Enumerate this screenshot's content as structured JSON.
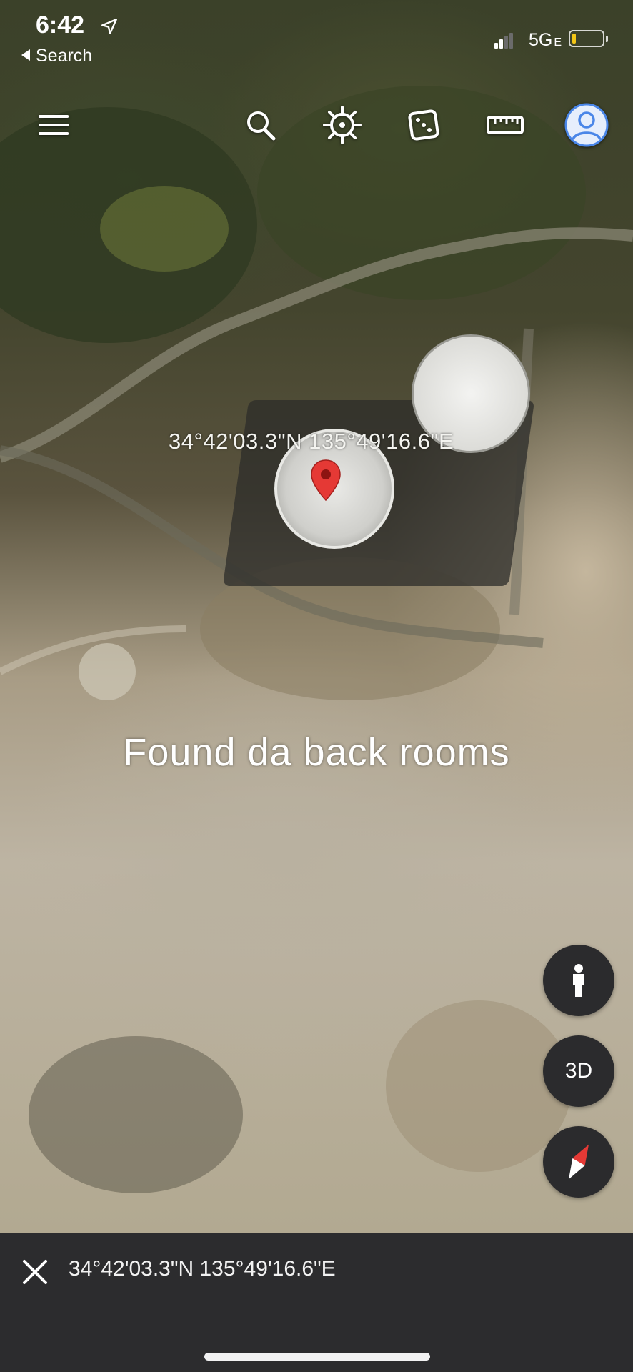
{
  "status_bar": {
    "time": "6:42",
    "back_label": "Search",
    "network": "5G",
    "network_suffix": "E",
    "battery_color": "#f2c616"
  },
  "toolbar": {
    "icons": [
      "menu-icon",
      "search-icon",
      "voyager-icon",
      "feeling-lucky-dice-icon",
      "measure-ruler-icon",
      "account-icon"
    ]
  },
  "map": {
    "pin_coordinates": "34°42'03.3\"N 135°49'16.6\"E",
    "pin_color": "#e53935",
    "caption": "Found da back rooms"
  },
  "controls": {
    "street_view_icon": "pegman-icon",
    "view_mode_label": "3D",
    "compass_icon": "compass-icon"
  },
  "bottom_bar": {
    "coordinates": "34°42'03.3\"N 135°49'16.6\"E",
    "close_icon": "close-icon"
  }
}
